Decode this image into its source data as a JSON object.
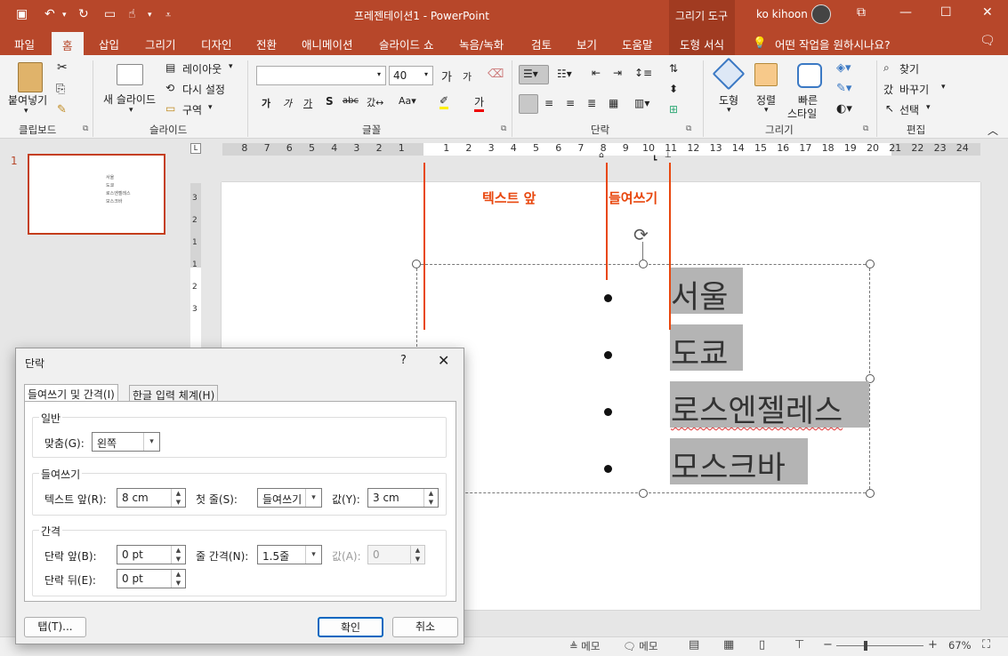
{
  "app": {
    "doc_title": "프레젠테이션1  -  PowerPoint",
    "context_tool": "그리기 도구",
    "user": "ko kihoon",
    "colors": {
      "accent": "#b7472a",
      "annotation": "#e8470e",
      "dialog_ok_border": "#0067c0"
    }
  },
  "tabs": [
    "파일",
    "홈",
    "삽입",
    "그리기",
    "디자인",
    "전환",
    "애니메이션",
    "슬라이드 쇼",
    "녹음/녹화",
    "검토",
    "보기",
    "도움말",
    "도형 서식"
  ],
  "tell_me": "어떤 작업을 원하시나요?",
  "ribbon": {
    "clipboard": {
      "paste": "붙여넣기",
      "label": "클립보드"
    },
    "slides": {
      "new_slide": "새 슬라이드",
      "layout": "레이아웃",
      "reset": "다시 설정",
      "section": "구역",
      "label": "슬라이드"
    },
    "font": {
      "font_name": "",
      "font_size": "40",
      "label": "글꼴"
    },
    "paragraph": {
      "label": "단락"
    },
    "drawing": {
      "shapes": "도형",
      "arrange": "정렬",
      "quick_styles_1": "빠른",
      "quick_styles_2": "스타일",
      "label": "그리기"
    },
    "editing": {
      "find": "찾기",
      "replace": "바꾸기",
      "select": "선택",
      "label": "편집"
    }
  },
  "thumbnail": {
    "number": "1",
    "items": [
      "서울",
      "도쿄",
      "로스엔젤레스",
      "모스크바"
    ]
  },
  "ruler": {
    "left_labels": [
      "8",
      "7",
      "6",
      "5",
      "4",
      "3",
      "2",
      "1"
    ],
    "right_labels": [
      "1",
      "2",
      "3",
      "4",
      "5",
      "6",
      "7",
      "8",
      "9",
      "10",
      "11",
      "12",
      "13",
      "14",
      "15",
      "16",
      "17",
      "18",
      "19",
      "20",
      "21",
      "22",
      "23",
      "24"
    ]
  },
  "vruler_labels": [
    "3",
    "2",
    "1",
    "1",
    "2",
    "3"
  ],
  "slide": {
    "lines": [
      "서울",
      "도쿄",
      "로스엔젤레스",
      "모스크바"
    ],
    "annotation_before_text": "텍스트 앞",
    "annotation_indent": "들여쓰기"
  },
  "dialog": {
    "title": "단락",
    "help": "?",
    "tabs": [
      "들여쓰기 및 간격(I)",
      "한글 입력 체계(H)"
    ],
    "general": {
      "legend": "일반",
      "align_label": "맞춤(G):",
      "align_value": "왼쪽"
    },
    "indent": {
      "legend": "들여쓰기",
      "before_label": "텍스트 앞(R):",
      "before_value": "8 cm",
      "special_label": "첫 줄(S):",
      "special_value": "들여쓰기",
      "by_label": "값(Y):",
      "by_value": "3 cm"
    },
    "spacing": {
      "legend": "간격",
      "before_label": "단락 앞(B):",
      "before_value": "0 pt",
      "after_label": "단락 뒤(E):",
      "after_value": "0 pt",
      "line_label": "줄 간격(N):",
      "line_value": "1.5줄",
      "at_label": "값(A):",
      "at_value": "0"
    },
    "tabs_button": "탭(T)...",
    "ok": "확인",
    "cancel": "취소"
  },
  "status": {
    "notes": "메모",
    "comments": "메모",
    "zoom": "67%"
  }
}
